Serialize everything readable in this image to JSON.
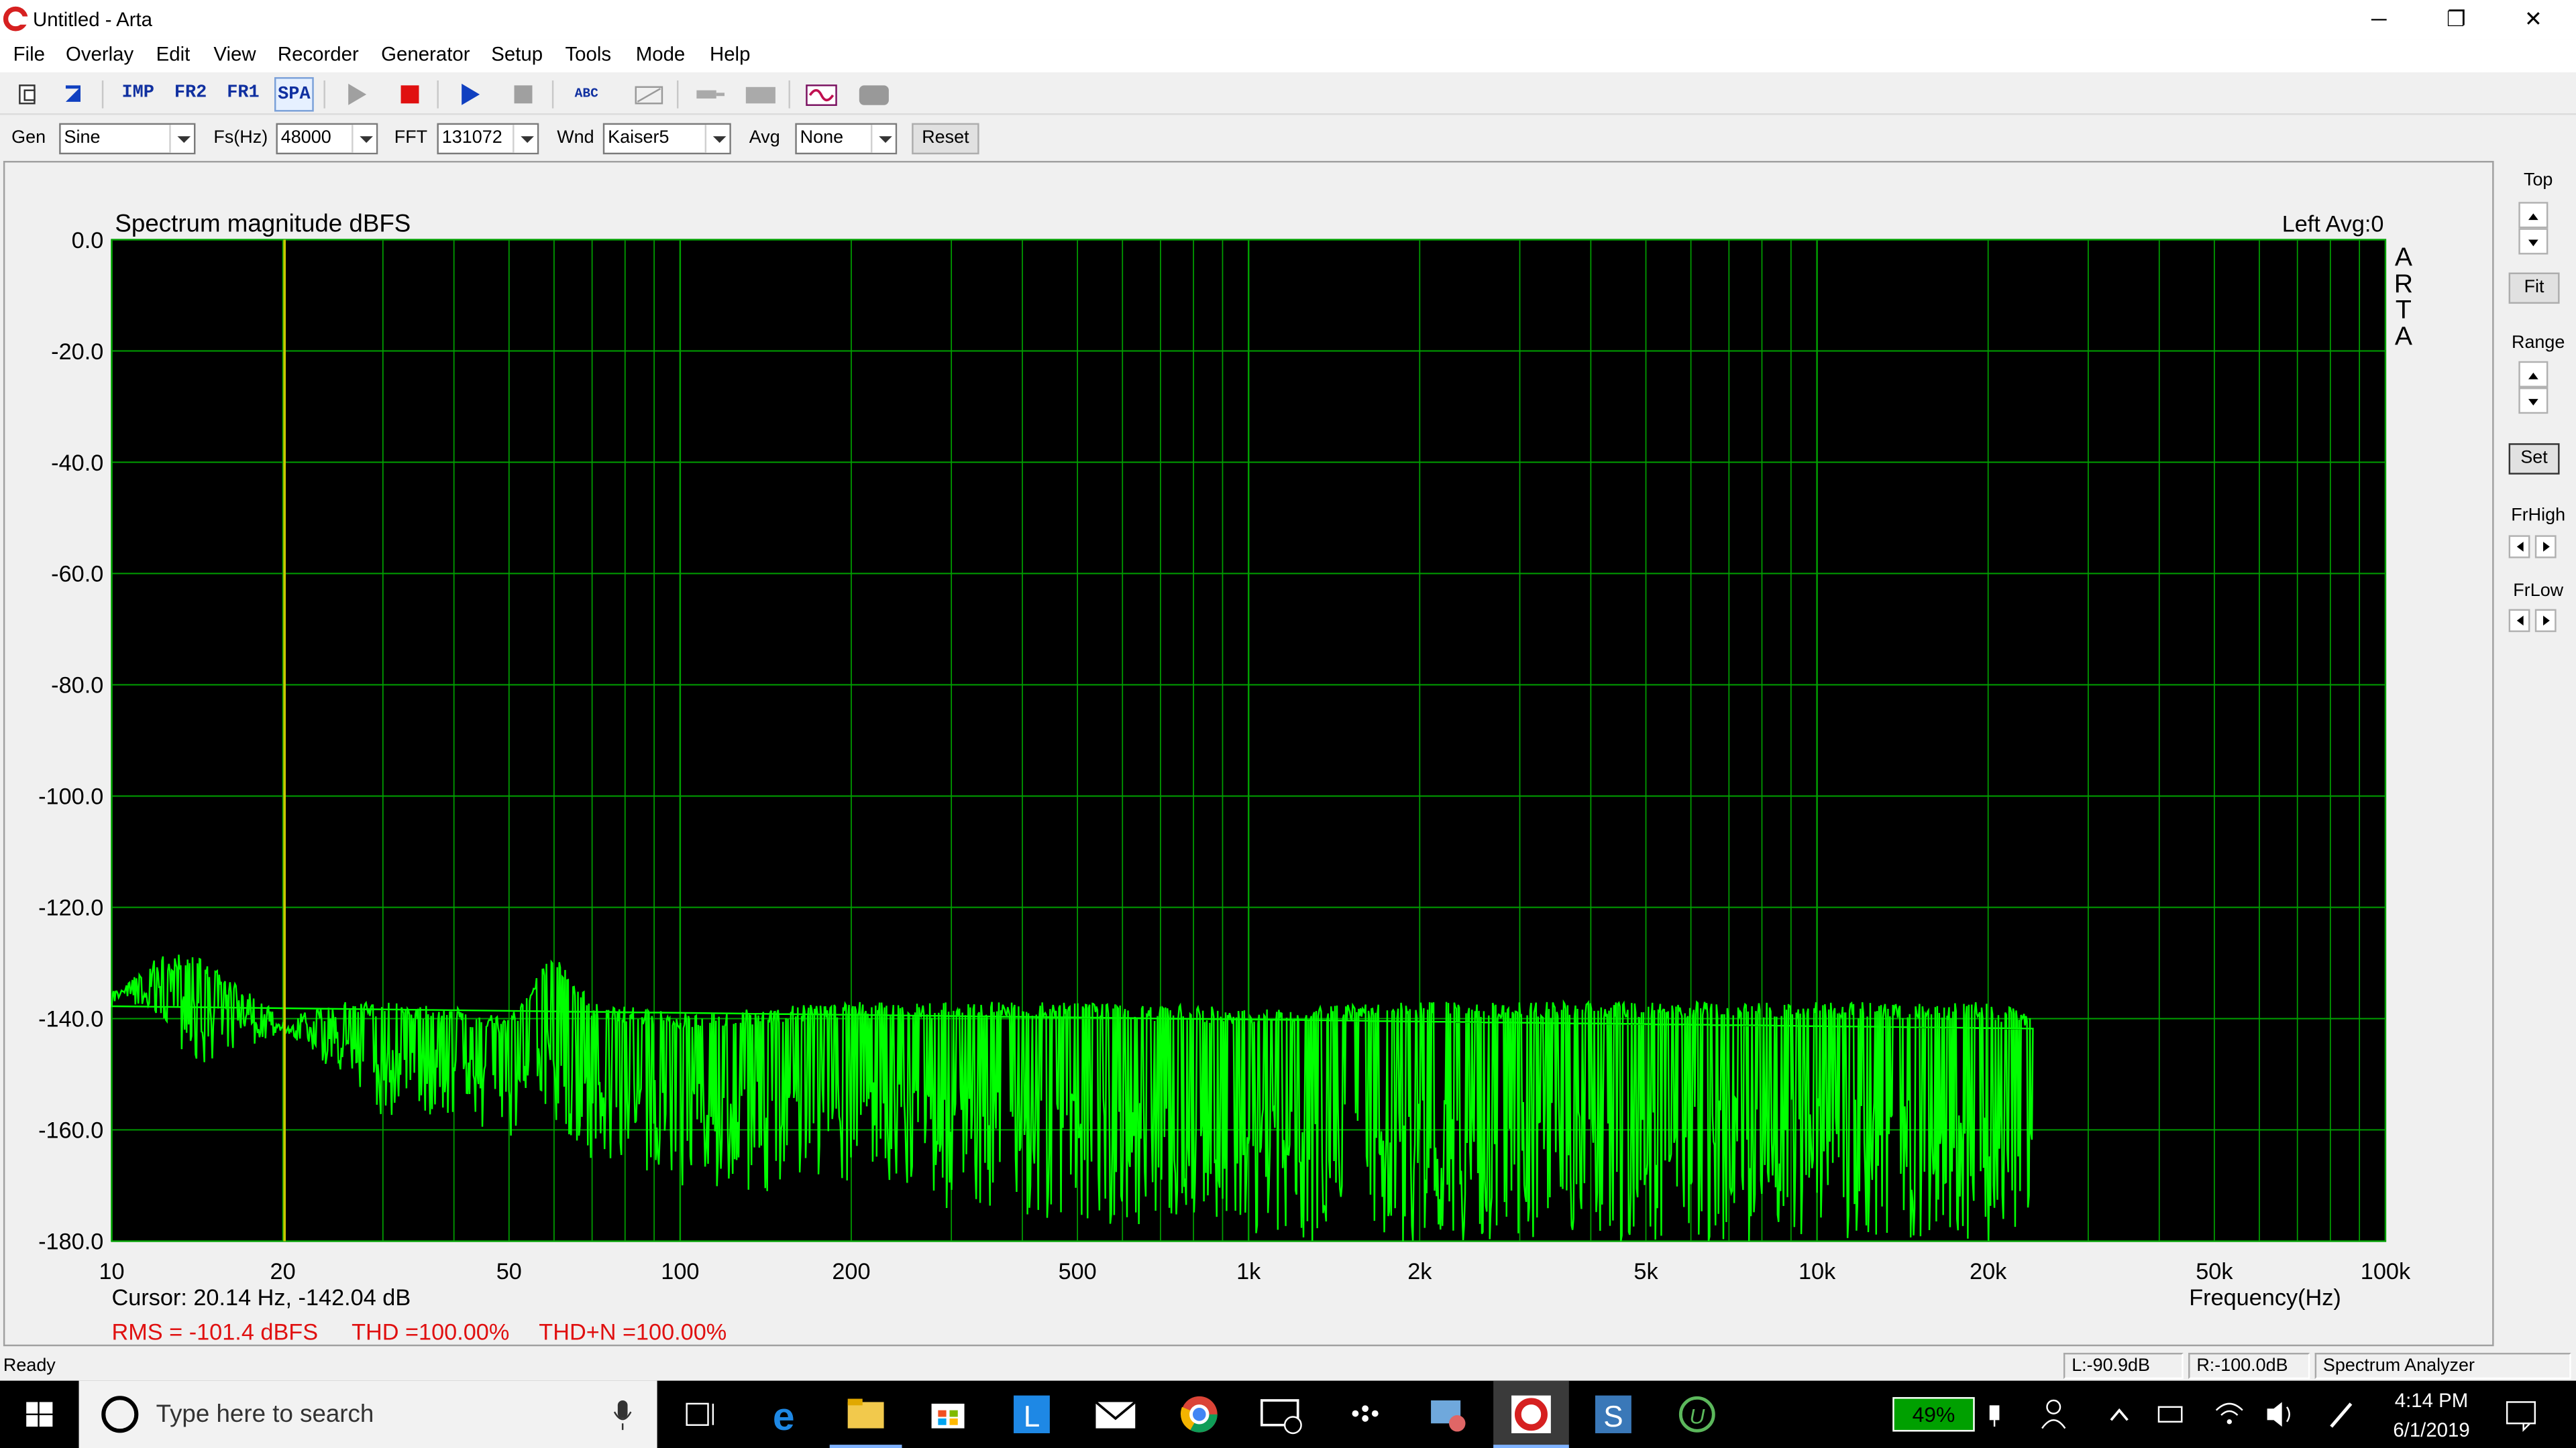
{
  "window": {
    "title": "Untitled - Arta",
    "minimize": "─",
    "restore": "❐",
    "close": "✕"
  },
  "menu": [
    "File",
    "Overlay",
    "Edit",
    "View",
    "Recorder",
    "Generator",
    "Setup",
    "Tools",
    "Mode",
    "Help"
  ],
  "toolbar": {
    "imp": "IMP",
    "fr2": "FR2",
    "fr1": "FR1",
    "spa": "SPA",
    "abc": "ABC"
  },
  "controls": {
    "gen_label": "Gen",
    "gen_value": "Sine",
    "fs_label": "Fs(Hz)",
    "fs_value": "48000",
    "fft_label": "FFT",
    "fft_value": "131072",
    "wnd_label": "Wnd",
    "wnd_value": "Kaiser5",
    "avg_label": "Avg",
    "avg_value": "None",
    "reset_label": "Reset"
  },
  "side": {
    "top": "Top",
    "fit": "Fit",
    "range": "Range",
    "set": "Set",
    "frhigh": "FrHigh",
    "frlow": "FrLow"
  },
  "plot": {
    "title": "Spectrum magnitude dBFS",
    "channel": "Left  Avg:0",
    "watermark": [
      "A",
      "R",
      "T",
      "A"
    ],
    "xlabel": "Frequency(Hz)",
    "cursor": "Cursor: 20.14 Hz, -142.04 dB",
    "rms": "RMS = -101.4 dBFS",
    "thd": "THD =100.00%",
    "thdn": "THD+N =100.00%",
    "y_ticks": [
      "0.0",
      "-20.0",
      "-40.0",
      "-60.0",
      "-80.0",
      "-100.0",
      "-120.0",
      "-140.0",
      "-160.0",
      "-180.0"
    ],
    "x_ticks": [
      "10",
      "20",
      "50",
      "100",
      "200",
      "500",
      "1k",
      "2k",
      "5k",
      "10k",
      "20k",
      "50k",
      "100k"
    ],
    "colors": {
      "background": "#000000",
      "grid": "#00a000",
      "trace": "#00ff00",
      "cursor": "#c8c800",
      "info": "#e01010"
    }
  },
  "chart_data": {
    "type": "line",
    "title": "Spectrum magnitude dBFS",
    "xlabel": "Frequency(Hz)",
    "ylabel": "",
    "x_scale": "log",
    "xlim": [
      10,
      100000
    ],
    "ylim": [
      -180,
      0
    ],
    "grid": true,
    "cursor": {
      "x": 20.14,
      "y": -142.04
    },
    "series": [
      {
        "x": [
          10,
          12,
          14,
          16,
          18,
          20,
          25,
          30,
          40,
          50,
          60,
          70,
          100,
          200,
          500,
          1000,
          2000,
          5000,
          10000,
          20000,
          24000
        ],
        "upper": [
          -135,
          -129,
          -128,
          -133,
          -136,
          -140,
          -137,
          -137,
          -138,
          -140,
          -128,
          -137,
          -139,
          -137,
          -137,
          -138,
          -137,
          -137,
          -137,
          -137,
          -139
        ],
        "lower": [
          -135,
          -140,
          -149,
          -146,
          -145,
          -142,
          -150,
          -158,
          -157,
          -162,
          -158,
          -166,
          -170,
          -172,
          -177,
          -180,
          -180,
          -180,
          -180,
          -180,
          -180
        ]
      }
    ]
  },
  "status": {
    "ready": "Ready",
    "left": "L:-90.9dB",
    "right": "R:-100.0dB",
    "mode": "Spectrum Analyzer"
  },
  "taskbar": {
    "search_placeholder": "Type here to search",
    "battery": "49%",
    "time": "4:14 PM",
    "date": "6/1/2019"
  }
}
